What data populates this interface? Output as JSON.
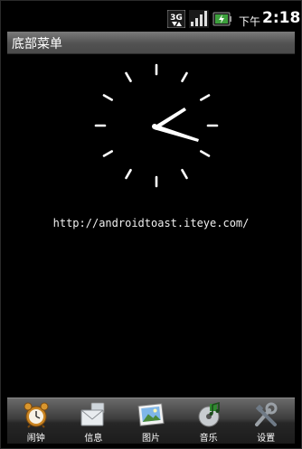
{
  "status_bar": {
    "network_badge": "3G",
    "ampm": "下午",
    "time": "2:18",
    "icons": [
      "3g-icon",
      "signal-icon",
      "battery-charging-icon"
    ]
  },
  "title_bar": {
    "title": "底部菜单"
  },
  "content": {
    "url": "http://androidtoast.iteye.com/",
    "clock_icon": "analog-clock"
  },
  "bottom_menu": {
    "items": [
      {
        "label": "闹钟",
        "icon": "alarm-clock-icon"
      },
      {
        "label": "信息",
        "icon": "envelope-icon"
      },
      {
        "label": "图片",
        "icon": "picture-icon"
      },
      {
        "label": "音乐",
        "icon": "music-icon"
      },
      {
        "label": "设置",
        "icon": "tools-icon"
      }
    ]
  },
  "colors": {
    "background": "#000000",
    "title_bar": "#5e5e5e",
    "menu_bar": "#3a3a3a",
    "text": "#ffffff"
  }
}
